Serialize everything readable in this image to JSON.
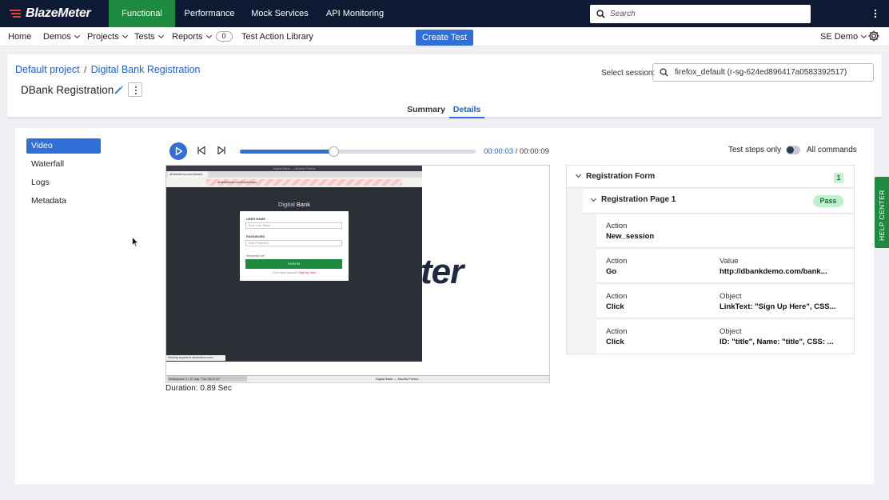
{
  "brand": {
    "name": "BlazeMeter"
  },
  "top_nav": {
    "items": [
      {
        "label": "Functional",
        "active": true
      },
      {
        "label": "Performance"
      },
      {
        "label": "Mock Services"
      },
      {
        "label": "API Monitoring"
      }
    ],
    "search_placeholder": "Search"
  },
  "sub_nav": {
    "home": "Home",
    "demos": "Demos",
    "projects": "Projects",
    "tests": "Tests",
    "reports": "Reports",
    "reports_count": "0",
    "library": "Test Action Library",
    "create_test": "Create Test",
    "account": "SE Demo"
  },
  "header": {
    "breadcrumb_project": "Default project",
    "breadcrumb_sep": "/",
    "breadcrumb_test": "Digital Bank Registration",
    "title": "DBank Registration",
    "session_label": "Select session:",
    "session_value": "firefox_default (r-sg-624ed896417a0583392517)",
    "tabs": [
      {
        "label": "Summary"
      },
      {
        "label": "Details",
        "active": true
      }
    ]
  },
  "sidebar": {
    "items": [
      {
        "label": "Video",
        "active": true
      },
      {
        "label": "Waterfall"
      },
      {
        "label": "Logs"
      },
      {
        "label": "Metadata"
      }
    ]
  },
  "player": {
    "current_time": "00:00:03",
    "separator": "/",
    "total_time": "00:00:09",
    "progress_fraction": 0.395,
    "steps_only_label": "Test steps only",
    "all_commands_label": "All commands",
    "duration": "Duration: 0.89 Sec"
  },
  "video": {
    "window_title": "Digital Bank — Mozilla Firefox",
    "tab_label": "dbankdemo.com/bank/l",
    "url": "dbankdemo.com/bank/login",
    "brand_light": "Digital",
    "brand_bold": "Bank",
    "user_label": "USER NAME",
    "user_placeholder": "Enter User Name",
    "pass_label": "PASSWORD",
    "pass_placeholder": "Enter Password",
    "remember": "Remember Me",
    "sign_in": "SIGN IN",
    "signup_prefix": "Don't have account?",
    "signup_link": "Sign Up Here",
    "status": "Sending request to dbankdemo.com...",
    "bg_text": "ter",
    "taskbar_workspace": "Workspace 1 • 07 Apr, Thu 05:27:07",
    "taskbar_title": "Digital Bank — Mozilla Firefox"
  },
  "steps": {
    "group_title": "Registration Form",
    "group_count": "1",
    "sub_title": "Registration Page 1",
    "sub_status": "Pass",
    "rows": [
      {
        "k1": "Action",
        "v1": "New_session",
        "k2": "",
        "v2": ""
      },
      {
        "k1": "Action",
        "v1": "Go",
        "k2": "Value",
        "v2": "http://dbankdemo.com/bank..."
      },
      {
        "k1": "Action",
        "v1": "Click",
        "k2": "Object",
        "v2": "LinkText: \"Sign Up Here\", CSS..."
      },
      {
        "k1": "Action",
        "v1": "Click",
        "k2": "Object",
        "v2": "ID: \"title\", Name: \"title\", CSS: ..."
      }
    ]
  },
  "help_center": "HELP CENTER",
  "colors": {
    "topbar": "#0e1a33",
    "accent": "#2f6fd6",
    "functional_green": "#1c8a3f",
    "pass_bg": "#bdf0cc"
  }
}
